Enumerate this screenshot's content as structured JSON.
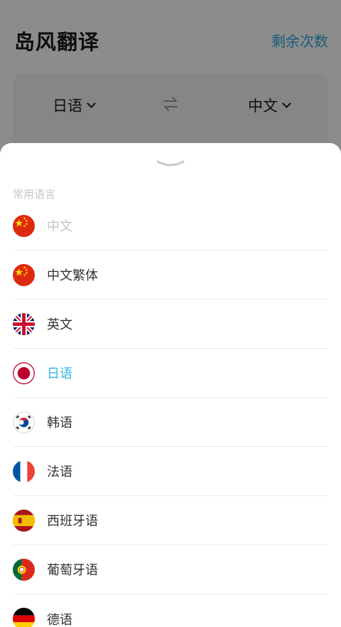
{
  "app": {
    "title": "岛风翻译",
    "remaining_label": "剩余次数",
    "source_lang": "日语",
    "target_lang": "中文",
    "accent_color": "#2aa8d8"
  },
  "sheet": {
    "section_title": "常用语言",
    "items": [
      {
        "label": "中文",
        "flag": "china-flag-icon",
        "state": "disabled"
      },
      {
        "label": "中文繁体",
        "flag": "china-flag-icon",
        "state": "normal"
      },
      {
        "label": "英文",
        "flag": "uk-flag-icon",
        "state": "normal"
      },
      {
        "label": "日语",
        "flag": "japan-flag-icon",
        "state": "selected"
      },
      {
        "label": "韩语",
        "flag": "korea-flag-icon",
        "state": "normal"
      },
      {
        "label": "法语",
        "flag": "france-flag-icon",
        "state": "normal"
      },
      {
        "label": "西班牙语",
        "flag": "spain-flag-icon",
        "state": "normal"
      },
      {
        "label": "葡萄牙语",
        "flag": "portugal-flag-icon",
        "state": "normal"
      },
      {
        "label": "德语",
        "flag": "germany-flag-icon",
        "state": "normal"
      }
    ],
    "selected_color": "#35b5e5"
  }
}
